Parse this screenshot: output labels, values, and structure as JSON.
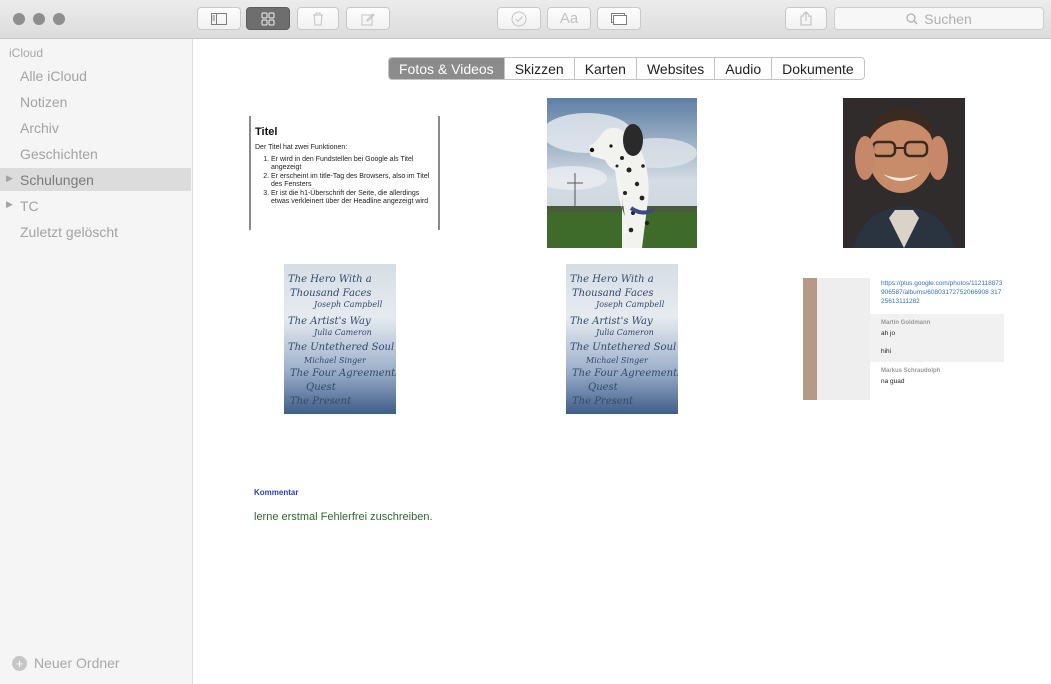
{
  "toolbar": {
    "buttons": [
      {
        "name": "sidebar-toggle-icon"
      },
      {
        "name": "attachments-grid-icon"
      },
      {
        "name": "trash-icon"
      },
      {
        "name": "compose-icon"
      },
      {
        "name": "checklist-icon"
      },
      {
        "name": "format-icon",
        "label": "Aa"
      },
      {
        "name": "table-icon"
      },
      {
        "name": "share-icon"
      }
    ],
    "search_placeholder": "Suchen"
  },
  "sidebar": {
    "section": "iCloud",
    "items": [
      {
        "label": "Alle iCloud",
        "selected": false,
        "expandable": false
      },
      {
        "label": "Notizen",
        "selected": false,
        "expandable": false
      },
      {
        "label": "Archiv",
        "selected": false,
        "expandable": false
      },
      {
        "label": "Geschichten",
        "selected": false,
        "expandable": false
      },
      {
        "label": "Schulungen",
        "selected": true,
        "expandable": true
      },
      {
        "label": "TC",
        "selected": false,
        "expandable": true
      },
      {
        "label": "Zuletzt gelöscht",
        "selected": false,
        "expandable": false
      }
    ],
    "new_folder_label": "Neuer Ordner"
  },
  "tabs": [
    {
      "label": "Fotos & Videos",
      "active": true
    },
    {
      "label": "Skizzen",
      "active": false
    },
    {
      "label": "Karten",
      "active": false
    },
    {
      "label": "Websites",
      "active": false
    },
    {
      "label": "Audio",
      "active": false
    },
    {
      "label": "Dokumente",
      "active": false
    }
  ],
  "attachments": {
    "doc": {
      "title": "Titel",
      "intro": "Der Titel hat zwei Funktionen:",
      "items": [
        "Er wird in den Fundstellen bei Google als Titel angezeigt",
        "Er erscheint im title-Tag des Browsers, also im Titel des Fensters",
        "Er ist die h1-Überschrift der Seite, die allerdings etwas verkleinert über der Headline angezeigt wird"
      ]
    },
    "handwriting_lines": [
      "The Hero With a",
      "Thousand Faces",
      "Joseph Campbell",
      "The Artist's Way",
      "Julia Cameron",
      "The Untethered Soul",
      "Michael Singer",
      "The Four Agreements",
      "Quest",
      "The Present"
    ],
    "web": {
      "link": "https://plus.google.com/photos/112118873906587/albums/60803172752066908 31725613111282",
      "comments": [
        {
          "author": "Martin Goldmann",
          "lines": [
            "ah jo",
            "hihi"
          ]
        },
        {
          "author": "Markus Schraudolph",
          "lines": [
            "na guad"
          ]
        }
      ]
    }
  },
  "comment": {
    "label": "Kommentar",
    "text": "lerne erstmal Fehlerfrei zuschreiben."
  },
  "colors": {
    "tab_active": "#8c8c8c",
    "sidebar_bg": "#f5f5f5",
    "sidebar_selected": "#dcdcdc",
    "comment_label": "#2a3fbd",
    "comment_text": "#2d6b2d"
  }
}
